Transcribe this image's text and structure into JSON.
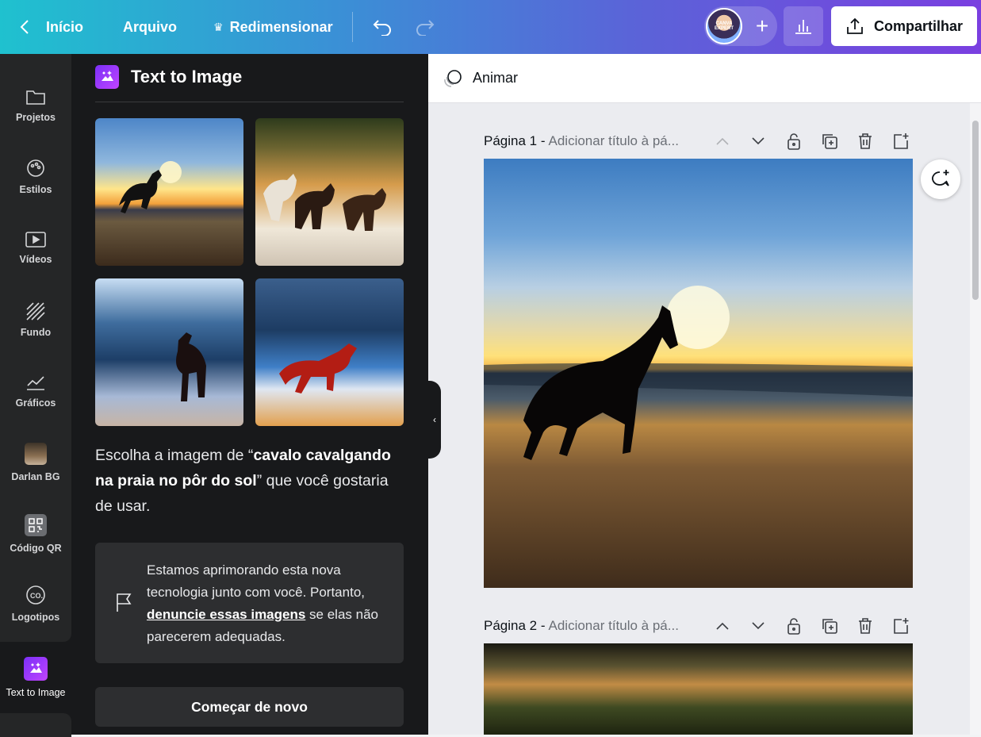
{
  "topbar": {
    "home_label": "Início",
    "file_label": "Arquivo",
    "resize_label": "Redimensionar",
    "avatar_text": "CANVA EXPERT",
    "share_label": "Compartilhar"
  },
  "rail": {
    "items": [
      {
        "label": "Projetos",
        "icon": "folder-icon"
      },
      {
        "label": "Estilos",
        "icon": "palette-icon"
      },
      {
        "label": "Vídeos",
        "icon": "video-icon"
      },
      {
        "label": "Fundo",
        "icon": "pattern-icon"
      },
      {
        "label": "Gráficos",
        "icon": "chart-icon"
      },
      {
        "label": "Darlan BG",
        "icon": "photo-icon"
      },
      {
        "label": "Código QR",
        "icon": "qr-icon"
      },
      {
        "label": "Logotipos",
        "icon": "logo-icon"
      }
    ],
    "active_label": "Text to Image"
  },
  "panel": {
    "title": "Text to Image",
    "prompt_prefix": "Escolha a imagem de “",
    "prompt_query": "cavalo cavalgando na praia no pôr do sol",
    "prompt_suffix": "” que você gostaria de usar.",
    "notice_before": "Estamos aprimorando esta nova tecnologia junto com você. Portanto, ",
    "notice_link": "denuncie essas imagens",
    "notice_after": " se elas não parecerem adequadas.",
    "restart_label": "Começar de novo"
  },
  "canvas": {
    "animate_label": "Animar",
    "pages": [
      {
        "label": "Página 1 -",
        "title_placeholder": "Adicionar título à pá..."
      },
      {
        "label": "Página 2 -",
        "title_placeholder": "Adicionar título à pá..."
      }
    ]
  },
  "colors": {
    "topbar_start": "#1fc1cf",
    "topbar_end": "#7a3fe0",
    "panel_bg": "#18191b",
    "rail_bg": "#252627"
  }
}
